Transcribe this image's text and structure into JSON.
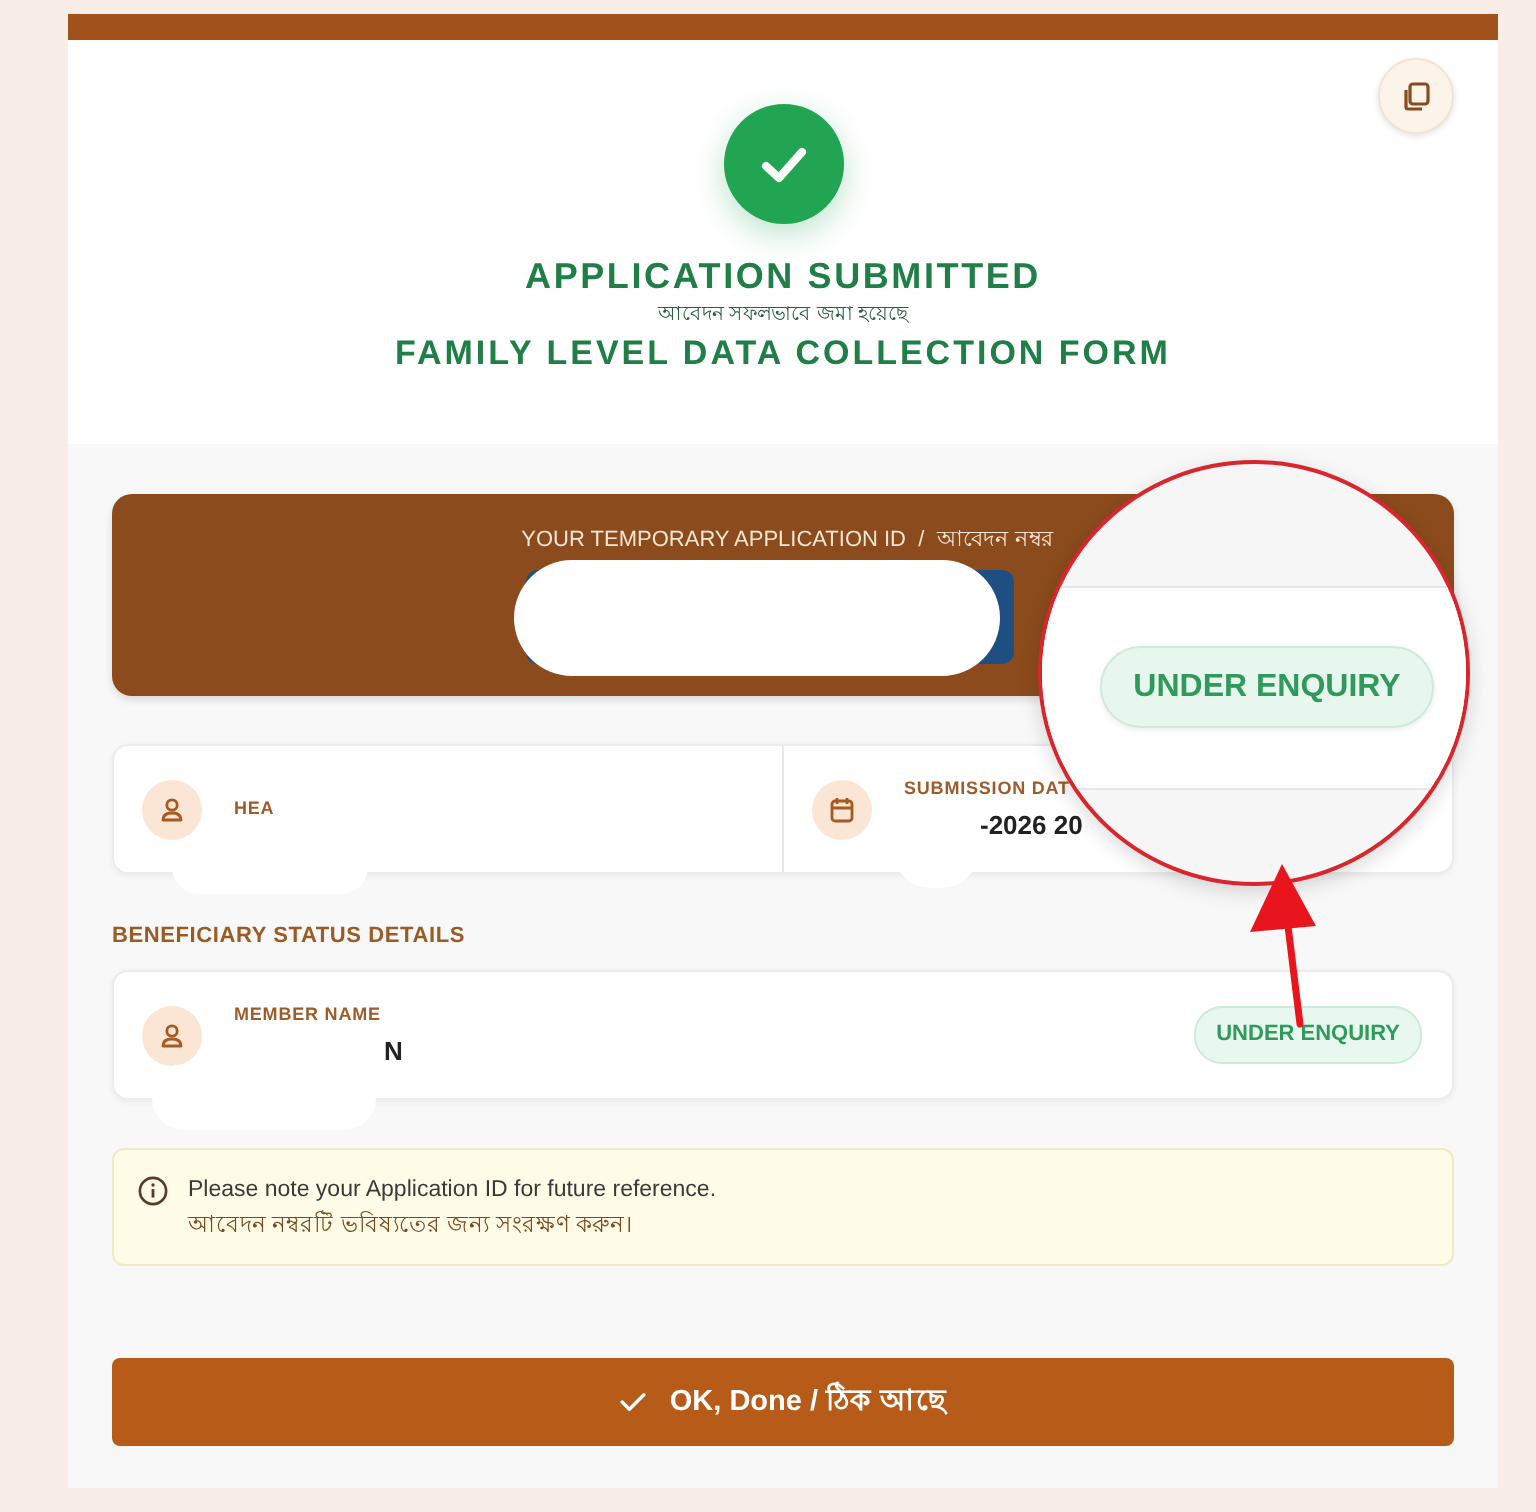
{
  "header": {
    "title": "APPLICATION SUBMITTED",
    "subtitle": "আবেদন সফলভাবে জমা হয়েছে",
    "form_name": "FAMILY LEVEL DATA COLLECTION FORM"
  },
  "application_id_card": {
    "label": "YOUR TEMPORARY APPLICATION ID  /  আবেদন নম্বর"
  },
  "summary": [
    {
      "kind": "person",
      "label": "HEA"
    },
    {
      "kind": "calendar",
      "label": "SUBMISSION DAT",
      "value": "-2026 20"
    }
  ],
  "beneficiary_section": {
    "heading": "BENEFICIARY STATUS DETAILS",
    "members": [
      {
        "label": "MEMBER NAME",
        "name": "N",
        "status": "UNDER ENQUIRY"
      }
    ]
  },
  "note": {
    "lines": [
      "Please note your Application ID for future reference.",
      "আবেদন নম্বরটি ভবিষ্যতের জন্য সংরক্ষণ করুন।"
    ]
  },
  "primary_button": {
    "label": "OK, Done / ঠিক আছে"
  },
  "callout": {
    "status": "UNDER ENQUIRY"
  }
}
